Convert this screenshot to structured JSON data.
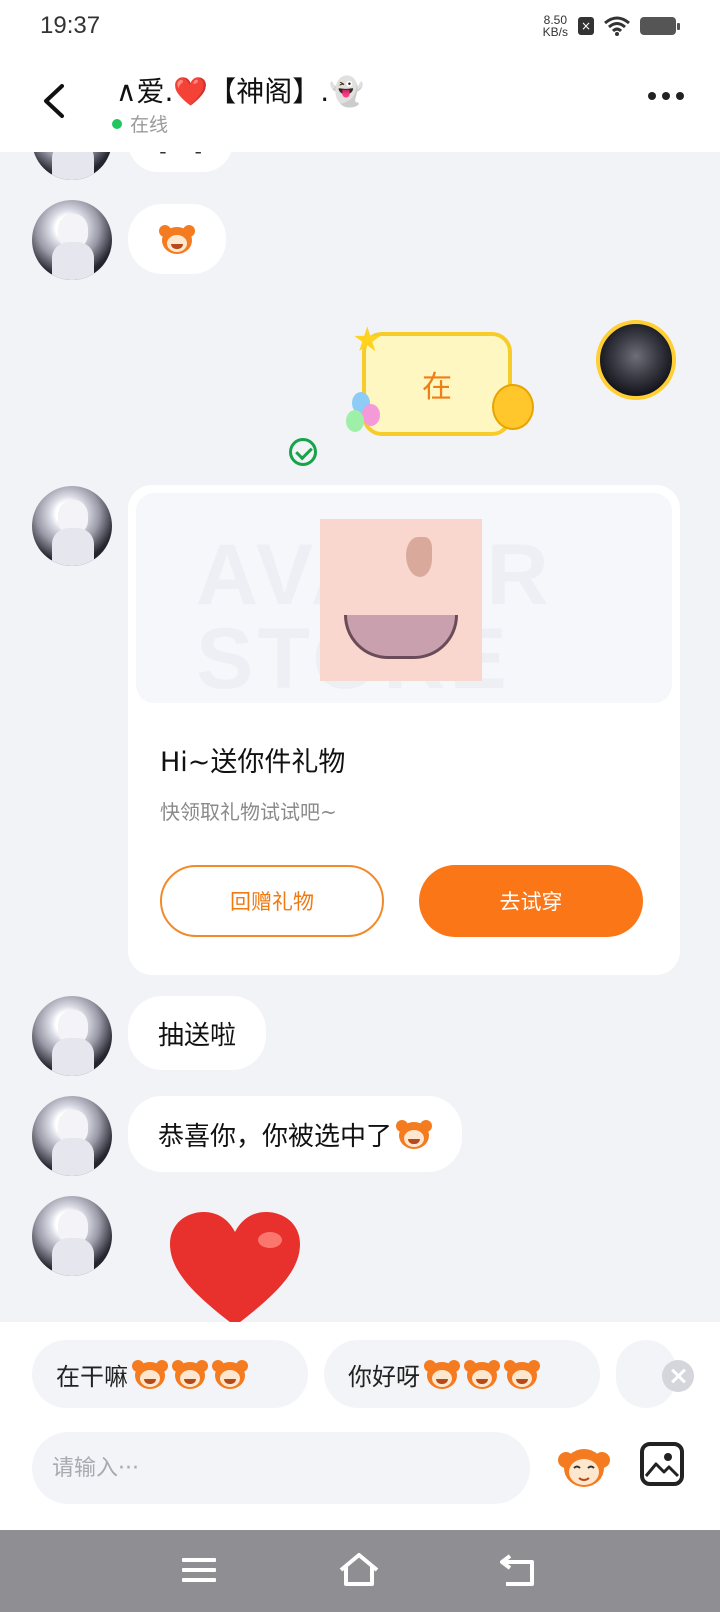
{
  "status_bar": {
    "time": "19:37",
    "net_speed_value": "8.50",
    "net_speed_unit": "KB/s"
  },
  "header": {
    "title_prefix": "∧爱.",
    "title_heart": "❤️",
    "title_suffix": "【神阁】.👻",
    "status": "在线"
  },
  "messages": {
    "bubble_top_partial": "[...]",
    "sticker_text": "在",
    "gift_card": {
      "watermark": "AVATAR STORE",
      "title": "Hi~送你件礼物",
      "subtitle": "快领取礼物试试吧~",
      "return_gift_label": "回赠礼物",
      "try_on_label": "去试穿"
    },
    "text_1": "抽送啦",
    "text_2": "恭喜你，你被选中了"
  },
  "quick_replies": [
    {
      "text": "在干嘛"
    },
    {
      "text": "你好呀"
    }
  ],
  "input": {
    "placeholder": "请输入···"
  },
  "icons": {
    "back": "back-arrow-icon",
    "more": "more-dots-icon",
    "check": "sent-check-icon",
    "sticker": "sticker-icon",
    "image": "image-icon",
    "nav_menu": "menu-icon",
    "nav_home": "home-icon",
    "nav_back": "back-icon"
  },
  "colors": {
    "accent": "#fb7616",
    "online": "#22c55e",
    "background": "#f2f3f7"
  }
}
